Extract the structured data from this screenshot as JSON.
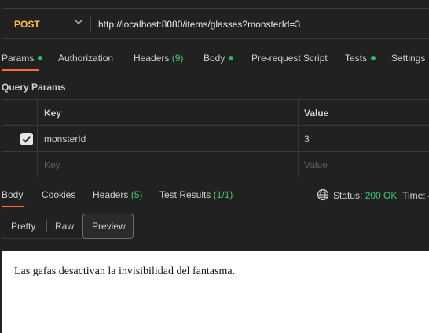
{
  "request": {
    "method": "POST",
    "url": "http://localhost:8080/items/glasses?monsterId=3"
  },
  "request_tabs": [
    {
      "label": "Params",
      "dot": true
    },
    {
      "label": "Authorization"
    },
    {
      "label": "Headers",
      "count": "(9)"
    },
    {
      "label": "Body",
      "dot": true
    },
    {
      "label": "Pre-request Script"
    },
    {
      "label": "Tests",
      "dot": true
    },
    {
      "label": "Settings"
    }
  ],
  "query_params": {
    "title": "Query Params",
    "headers": {
      "key": "Key",
      "value": "Value"
    },
    "rows": [
      {
        "checked": true,
        "key": "monsterId",
        "value": "3"
      }
    ],
    "placeholder": {
      "key": "Key",
      "value": "Value"
    }
  },
  "response_tabs": [
    {
      "label": "Body"
    },
    {
      "label": "Cookies"
    },
    {
      "label": "Headers",
      "count": "(5)"
    },
    {
      "label": "Test Results",
      "count": "(1/1)"
    }
  ],
  "status": {
    "label": "Status:",
    "value": "200 OK",
    "time_label": "Time:",
    "time_partial": "4"
  },
  "view_modes": {
    "pretty": "Pretty",
    "raw": "Raw",
    "preview": "Preview",
    "active": "Preview"
  },
  "response_preview": {
    "text": "Las gafas desactivan la invisibilidad del fantasma."
  },
  "colors": {
    "method": "#ffc24b",
    "accent": "#ff6c37",
    "success": "#3ccc6c",
    "background": "#212121"
  },
  "icons": {
    "method_dropdown": "chevron-down-icon",
    "checkbox": "check-icon",
    "status": "globe-icon"
  }
}
